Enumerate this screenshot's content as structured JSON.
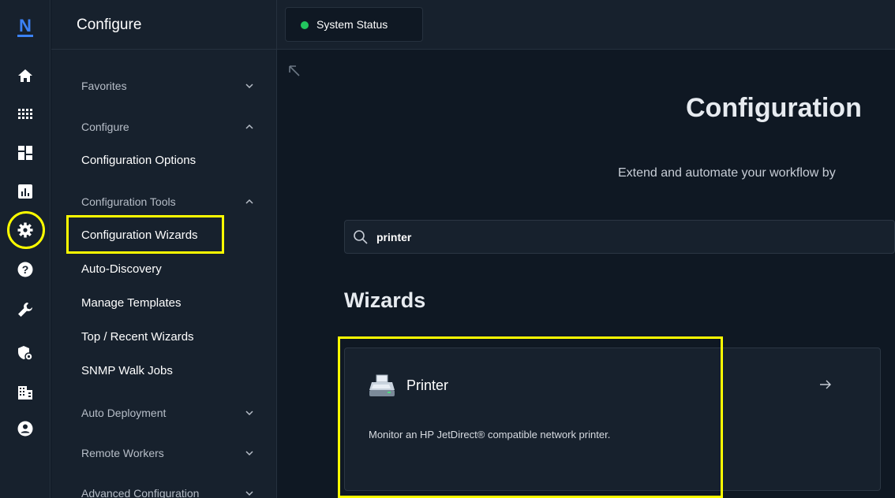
{
  "app": {
    "logo_letter": "N",
    "accent_color": "#ffff00",
    "status_color": "#22c55e"
  },
  "rail": {
    "icons": [
      "home-icon",
      "apps-grid-icon",
      "dashboard-icon",
      "reports-icon",
      "gear-icon",
      "help-icon",
      "wrench-icon",
      "security-icon",
      "building-icon",
      "account-icon"
    ]
  },
  "nav": {
    "title": "Configure",
    "groups": {
      "favorites": "Favorites",
      "configure": "Configure",
      "configuration_tools": "Configuration Tools",
      "auto_deployment": "Auto Deployment",
      "remote_workers": "Remote Workers",
      "advanced_configuration": "Advanced Configuration"
    },
    "links": {
      "configuration_options": "Configuration Options",
      "configuration_wizards": "Configuration Wizards",
      "auto_discovery": "Auto-Discovery",
      "manage_templates": "Manage Templates",
      "top_recent_wizards": "Top / Recent Wizards",
      "snmp_walk_jobs": "SNMP Walk Jobs"
    }
  },
  "topbar": {
    "status_label": "System Status"
  },
  "main": {
    "title": "Configuration",
    "subtitle": "Extend and automate your workflow by",
    "search_value": "printer",
    "section_title": "Wizards",
    "card": {
      "title": "Printer",
      "arrow": "→",
      "description": "Monitor an HP JetDirect® compatible network printer."
    }
  }
}
